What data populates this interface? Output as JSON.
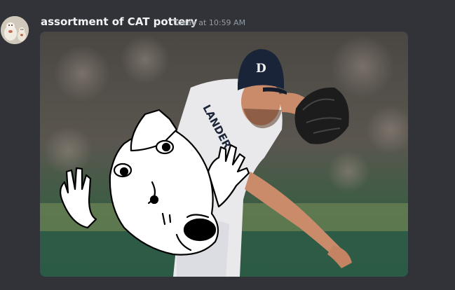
{
  "message": {
    "author": "assortment of CAT pottery",
    "timestamp": "Today at 10:59 AM",
    "avatar_icon": "pottery-cats-avatar",
    "attachment": {
      "kind": "image",
      "jersey_text": "LANDER",
      "cap_logo": "D"
    }
  },
  "colors": {
    "background": "#313338",
    "author": "#f2f3f5",
    "timestamp": "#949ba4"
  }
}
